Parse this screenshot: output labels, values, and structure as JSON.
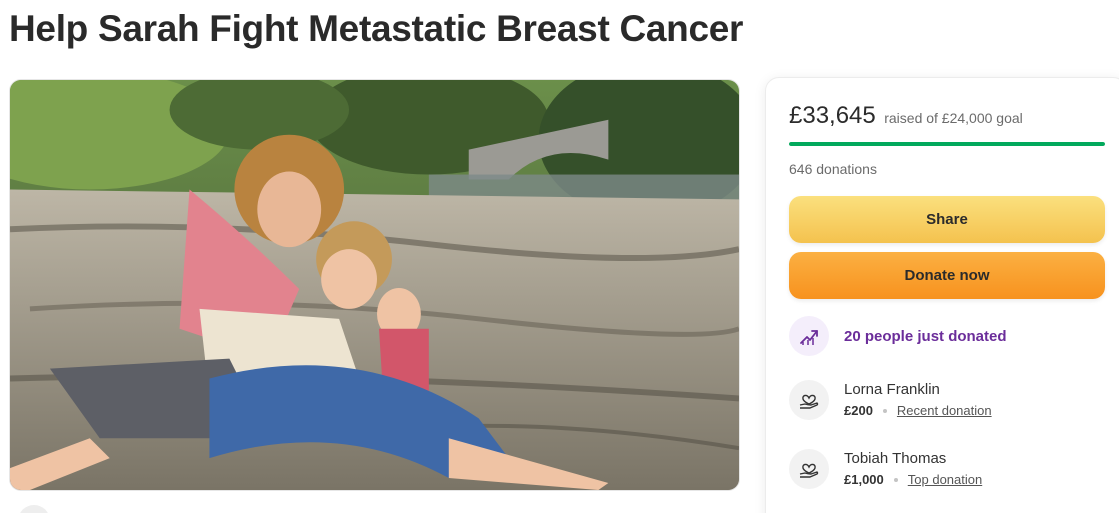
{
  "page": {
    "title": "Help Sarah Fight Metastatic Breast Cancer"
  },
  "hero_image": {
    "description_icon": "campaign-photo"
  },
  "donation_card": {
    "raised_amount": "£33,645",
    "raised_text": "raised of £24,000 goal",
    "progress_fraction": 1.0,
    "donation_count": "646 donations",
    "share_label": "Share",
    "donate_label": "Donate now",
    "recent_activity": {
      "icon": "trending-up-icon",
      "text": "20 people just donated"
    },
    "donors": [
      {
        "icon": "heart-hand-icon",
        "name": "Lorna Franklin",
        "amount": "£200",
        "tag": "Recent donation"
      },
      {
        "icon": "heart-hand-icon",
        "name": "Tobiah Thomas",
        "amount": "£1,000",
        "tag": "Top donation"
      }
    ]
  },
  "colors": {
    "progress": "#02a95c",
    "share_button": "#f6ca5a",
    "donate_button": "#f8a12e",
    "recent_text": "#6b2d9a"
  }
}
